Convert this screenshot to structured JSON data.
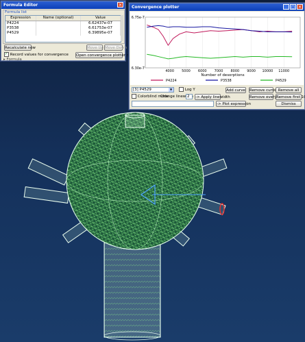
{
  "formula_editor": {
    "title": "Formula Editor",
    "group_label": "Formula list",
    "columns": [
      "Expression",
      "Name (optional)",
      "Value"
    ],
    "rows": [
      {
        "expr": "P4224",
        "name": "",
        "value": "6.62437e-07"
      },
      {
        "expr": "P3538",
        "name": "",
        "value": "6.61753e-07"
      },
      {
        "expr": "P4529",
        "name": "",
        "value": "6.39895e-07"
      }
    ],
    "recalculate_label": "Recalculate now",
    "move_up_label": "Move Up",
    "move_down_label": "Move Down",
    "record_label": "Record values for convergence",
    "open_plotter_label": "Open convergence plotter >>",
    "formula_label": "Formula"
  },
  "convergence_plotter": {
    "title": "Convergence plotter",
    "combo_value": "[3] P4529",
    "log_y_label": "Log Y",
    "add_curve_label": "Add curve",
    "remove_curve_label": "Remove curve",
    "remove_all_label": "Remove all",
    "colorblind_label": "Colorblind mode",
    "change_linewidth_label": "Change linewidth",
    "linewidth_value": "2",
    "apply_linewidth_label": "-> Apply linewidth",
    "remove_every_label": "Remove every 4th",
    "remove_first_label": "Remove first 100",
    "plot_expression_label": "-> Plot expression",
    "dismiss_label": "Dismiss"
  },
  "chart_data": {
    "type": "line",
    "xlabel": "Number of desorptions",
    "ylabel": "",
    "xlim": [
      2500,
      12000
    ],
    "ylim": [
      6.3e-07,
      6.75e-07
    ],
    "x_ticks": [
      "4000",
      "5000",
      "6000",
      "7000",
      "8000",
      "9000",
      "10000",
      "11000"
    ],
    "y_ticks": [
      "6.75e-7",
      "6.30e-7"
    ],
    "series": [
      {
        "name": "P4224",
        "color": "#c0185a",
        "x": [
          2600,
          3000,
          3300,
          3600,
          3900,
          4200,
          4600,
          5000,
          5500,
          6000,
          6500,
          7000,
          7500,
          8000,
          8500,
          9000,
          9500,
          10000,
          10500,
          11000,
          11500
        ],
        "y": [
          6.68e-07,
          6.66e-07,
          6.64e-07,
          6.58e-07,
          6.5e-07,
          6.56e-07,
          6.6e-07,
          6.62e-07,
          6.61e-07,
          6.62e-07,
          6.63e-07,
          6.625e-07,
          6.63e-07,
          6.635e-07,
          6.64e-07,
          6.63e-07,
          6.62e-07,
          6.625e-07,
          6.62e-07,
          6.62e-07,
          6.625e-07
        ]
      },
      {
        "name": "P3538",
        "color": "#1515a0",
        "x": [
          2600,
          3000,
          3300,
          3600,
          3900,
          4200,
          4600,
          5000,
          5500,
          6000,
          6500,
          7000,
          7500,
          8000,
          8500,
          9000,
          9500,
          10000,
          10500,
          11000,
          11500
        ],
        "y": [
          6.66e-07,
          6.67e-07,
          6.675e-07,
          6.67e-07,
          6.66e-07,
          6.665e-07,
          6.665e-07,
          6.66e-07,
          6.66e-07,
          6.665e-07,
          6.665e-07,
          6.655e-07,
          6.65e-07,
          6.645e-07,
          6.64e-07,
          6.63e-07,
          6.625e-07,
          6.62e-07,
          6.62e-07,
          6.62e-07,
          6.618e-07
        ]
      },
      {
        "name": "P4529",
        "color": "#22b822",
        "x": [
          2600,
          3000,
          3300,
          3600,
          3900,
          4200,
          4600,
          5000,
          5500,
          6000,
          6500,
          7000,
          7500,
          8000,
          8500,
          9000,
          9500,
          10000,
          10500,
          11000,
          11500
        ],
        "y": [
          6.42e-07,
          6.41e-07,
          6.4e-07,
          6.39e-07,
          6.38e-07,
          6.385e-07,
          6.395e-07,
          6.4e-07,
          6.395e-07,
          6.39e-07,
          6.385e-07,
          6.39e-07,
          6.395e-07,
          6.4e-07,
          6.395e-07,
          6.4e-07,
          6.4e-07,
          6.395e-07,
          6.4e-07,
          6.4e-07,
          6.399e-07
        ]
      }
    ]
  }
}
